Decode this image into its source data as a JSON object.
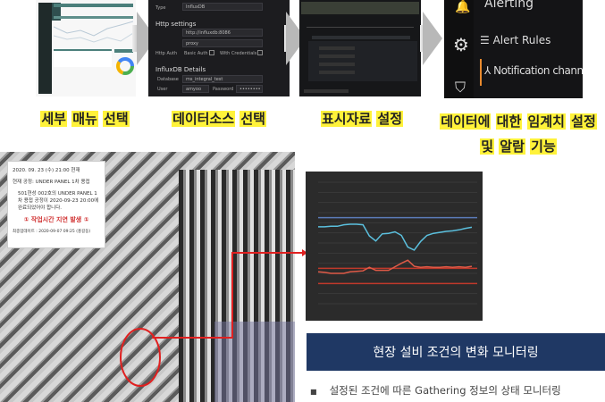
{
  "steps": [
    {
      "caption": [
        "세부",
        "매뉴",
        "선택"
      ]
    },
    {
      "caption": [
        "데이터소스",
        "선택"
      ]
    },
    {
      "caption": [
        "표시자료",
        "설정"
      ]
    },
    {
      "caption": [
        "데이터에",
        "대한",
        "임계치",
        "설정",
        "및",
        "알람",
        "기능"
      ]
    }
  ],
  "datasource": {
    "type_label": "Type",
    "type_value": "InfluxDB",
    "http_section": "Http settings",
    "url": "http://influxdb:8086",
    "access": "proxy",
    "http_auth": "Http Auth",
    "basic_auth": "Basic Auth",
    "with_credentials": "With Credentials",
    "details_section": "InfluxDB Details",
    "database_label": "Database",
    "database": "ms_integral_test",
    "user_label": "User",
    "user": "amyoo",
    "password_label": "Password",
    "password": "••••••••"
  },
  "alerting": {
    "header": "Alerting",
    "items": [
      {
        "label": "Alert Rules",
        "icon": "list-icon"
      },
      {
        "label": "Notification channels",
        "icon": "notification-icon"
      }
    ]
  },
  "popup": {
    "timestamp": "2020. 09. 23 (수) 21:00 현재",
    "process": "현재 공정: UNDER PANEL 1차 용접",
    "detail": "501현성 002호의 UNDER PANEL 1차 용접 공정이 2020-09-23 20:00에 완료되었어야 합니다.",
    "alert": "① 작업시간 지연 발생 ①",
    "footer": "최종업데이트 : 2020-09-07 09:25 (홍길동)"
  },
  "chart_data": {
    "type": "line",
    "series": [
      {
        "color": "#5bc0de",
        "values": [
          15.2,
          15.2,
          15.3,
          15.3,
          15.6,
          15.7,
          15.7,
          15.6,
          13.4,
          12.4,
          13.8,
          13.9,
          14.2,
          13.5,
          11.2,
          10.6,
          12.3,
          13.5,
          13.9,
          14.1,
          14.3,
          14.4,
          14.6,
          14.9,
          15.1
        ]
      },
      {
        "color": "#e05a47",
        "values": [
          6.3,
          6.2,
          6.0,
          6.0,
          6.0,
          6.3,
          6.4,
          6.5,
          7.2,
          6.6,
          6.6,
          6.6,
          7.3,
          8.0,
          8.6,
          7.4,
          7.2,
          7.3,
          7.2,
          7.2,
          7.3,
          7.2,
          7.3,
          7.2,
          7.4
        ]
      }
    ],
    "thresholds": [
      {
        "value": 17,
        "color": "#5b7bb8"
      },
      {
        "value": 7,
        "color": "#c0392b"
      },
      {
        "value": 4,
        "color": "#c0392b"
      }
    ],
    "ylim": [
      0,
      24
    ]
  },
  "footer": {
    "title": "현장 설비 조건의 변화 모니터링",
    "bullet": "설정된 조건에 따른 Gathering  정보의 상태 모니터링"
  }
}
